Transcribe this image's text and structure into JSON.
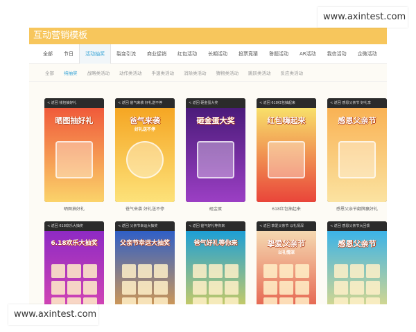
{
  "page_title": "互动营销模板",
  "tabs_primary": [
    "全部",
    "节日",
    "活动抽奖",
    "裂变引流",
    "商业促销",
    "红包活动",
    "长期活动",
    "投票竞猜",
    "答题活动",
    "AR活动",
    "我信活动",
    "企微活动"
  ],
  "tabs_primary_active": 2,
  "tabs_secondary": [
    "全部",
    "纯抽奖",
    "战略类活动",
    "动作类活动",
    "手速类活动",
    "消除类活动",
    "猜物类活动",
    "跳跃类活动",
    "反应类活动"
  ],
  "tabs_secondary_active": 1,
  "templates": [
    {
      "top": "< 返回  钱包抽好礼",
      "headline": "晒图抽好礼",
      "caption": "晒图抽好礼",
      "colors": [
        "#f05a3a",
        "#fbd36a"
      ]
    },
    {
      "top": "< 返回  爸气来袭 好礼送不停",
      "headline": "爸气来袭",
      "sub": "好礼送不停",
      "caption": "爸气来袭 好礼送不停",
      "colors": [
        "#f5a623",
        "#fde27a"
      ]
    },
    {
      "top": "< 返回  砸金蛋大奖",
      "headline": "砸金蛋大奖",
      "caption": "砸金蛋",
      "colors": [
        "#4b1b7a",
        "#9b3fc4"
      ]
    },
    {
      "top": "< 返回  618红包抽起来",
      "headline": "红包嗨起来",
      "caption": "618红包抽起来",
      "colors": [
        "#f8e06a",
        "#e9453a"
      ]
    },
    {
      "top": "< 返回  感恩父亲节 好礼享",
      "headline": "感恩父亲节",
      "caption": "感恩父亲节翻牌赢好礼",
      "colors": [
        "#f9b254",
        "#fbe3a1"
      ]
    },
    {
      "top": "< 返回  618欢乐大抽奖",
      "headline": "6.18欢乐大抽奖",
      "caption": "",
      "colors": [
        "#8e2ac4",
        "#e24bb0"
      ]
    },
    {
      "top": "< 返回  父亲节幸运大抽奖",
      "headline": "父亲节幸运大抽奖",
      "caption": "",
      "colors": [
        "#2f5fc7",
        "#f7a63a"
      ]
    },
    {
      "top": "< 返回  爸气好礼等你来",
      "headline": "爸气好礼等你来",
      "caption": "",
      "colors": [
        "#1d9fd6",
        "#f0d54b"
      ]
    },
    {
      "top": "< 返回  挚爱父亲节 以礼情深",
      "headline": "挚爱父亲节",
      "sub": "以礼情深",
      "caption": "",
      "colors": [
        "#f5d9b1",
        "#e24b3a"
      ]
    },
    {
      "top": "< 返回  感恩父亲节大回馈",
      "headline": "感恩父亲节",
      "caption": "",
      "colors": [
        "#3cb3e8",
        "#f9e07a"
      ]
    }
  ],
  "watermark_top": "www.axintest.com",
  "watermark_bottom": "www.axintest.com"
}
